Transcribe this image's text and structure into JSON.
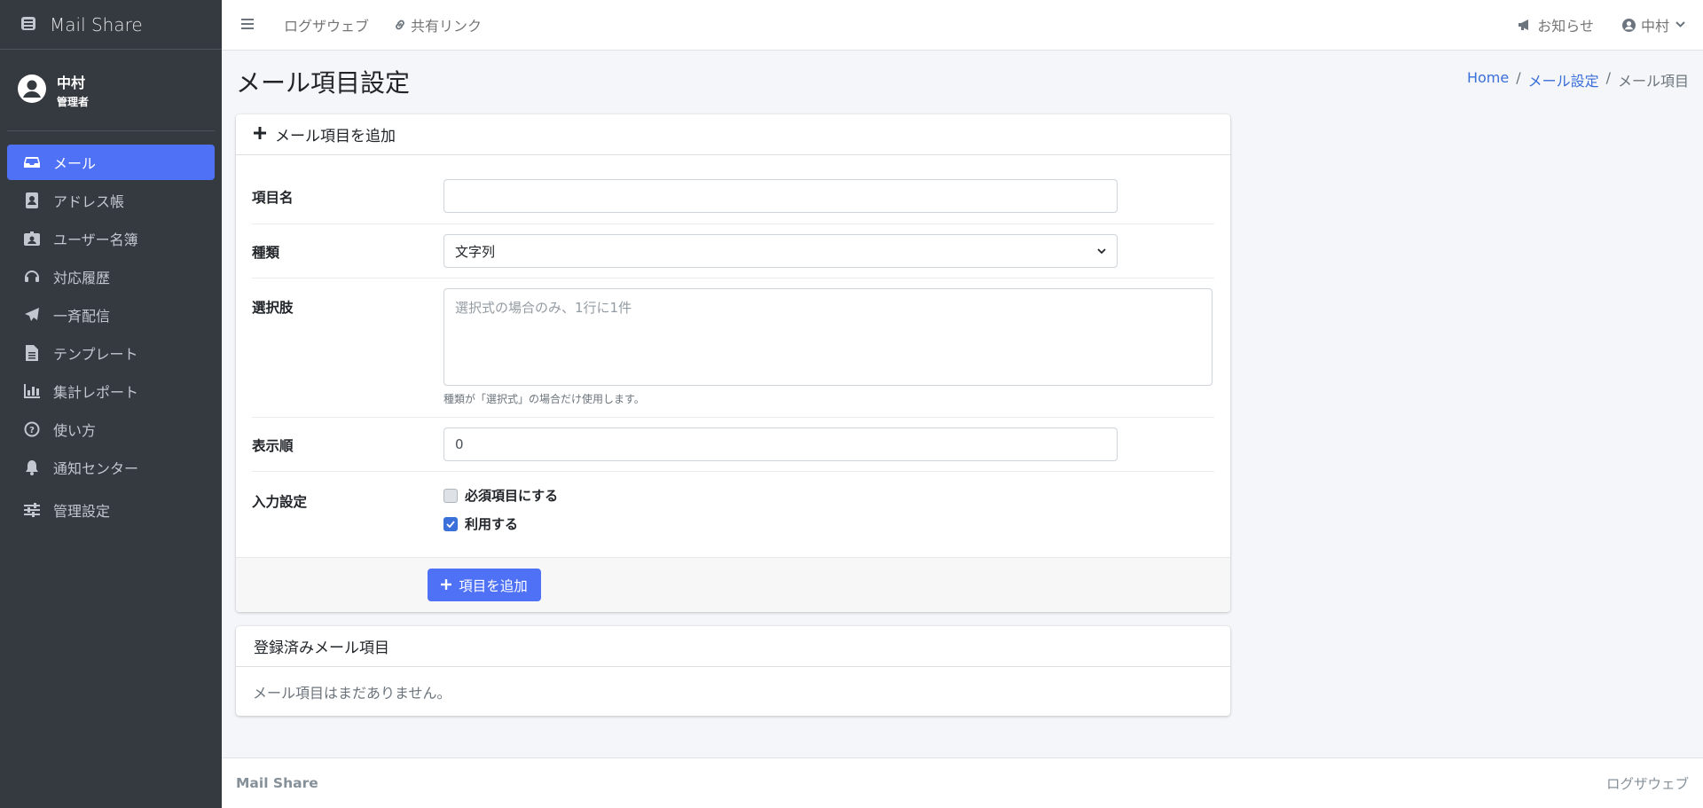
{
  "brand": {
    "name": "Mail Share"
  },
  "user": {
    "name": "中村",
    "role": "管理者"
  },
  "sidebar": {
    "items": [
      {
        "label": "メール",
        "icon": "inbox-icon",
        "active": true
      },
      {
        "label": "アドレス帳",
        "icon": "address-book-icon"
      },
      {
        "label": "ユーザー名簿",
        "icon": "id-badge-icon"
      },
      {
        "label": "対応履歴",
        "icon": "headset-icon"
      },
      {
        "label": "一斉配信",
        "icon": "paper-plane-icon"
      },
      {
        "label": "テンプレート",
        "icon": "file-icon"
      },
      {
        "label": "集計レポート",
        "icon": "chart-bar-icon"
      },
      {
        "label": "使い方",
        "icon": "question-circle-icon"
      },
      {
        "label": "通知センター",
        "icon": "bell-icon"
      },
      {
        "label": "管理設定",
        "icon": "sliders-icon"
      }
    ]
  },
  "topbar": {
    "links": [
      "ログザウェブ",
      "共有リンク"
    ],
    "notice": "お知らせ",
    "user_menu": "中村"
  },
  "page": {
    "title": "メール項目設定",
    "breadcrumb": [
      "Home",
      "メール設定",
      "メール項目"
    ]
  },
  "add_form": {
    "header": "メール項目を追加",
    "fields": {
      "name_label": "項目名",
      "name_value": "",
      "type_label": "種類",
      "type_value": "文字列",
      "options_label": "選択肢",
      "options_placeholder": "選択式の場合のみ、1行に1件",
      "options_help": "種類が「選択式」の場合だけ使用します。",
      "order_label": "表示順",
      "order_value": "0",
      "input_label": "入力設定",
      "required_label": "必須項目にする",
      "required_checked": false,
      "enabled_label": "利用する",
      "enabled_checked": true
    },
    "submit_label": "項目を追加"
  },
  "registered": {
    "header": "登録済みメール項目",
    "empty_text": "メール項目はまだありません。"
  },
  "footer": {
    "left": "Mail Share",
    "right": "ログザウェブ"
  },
  "colors": {
    "accent": "#4f71f5",
    "sidebar_bg": "#343a40",
    "link": "#3b6fd9"
  }
}
